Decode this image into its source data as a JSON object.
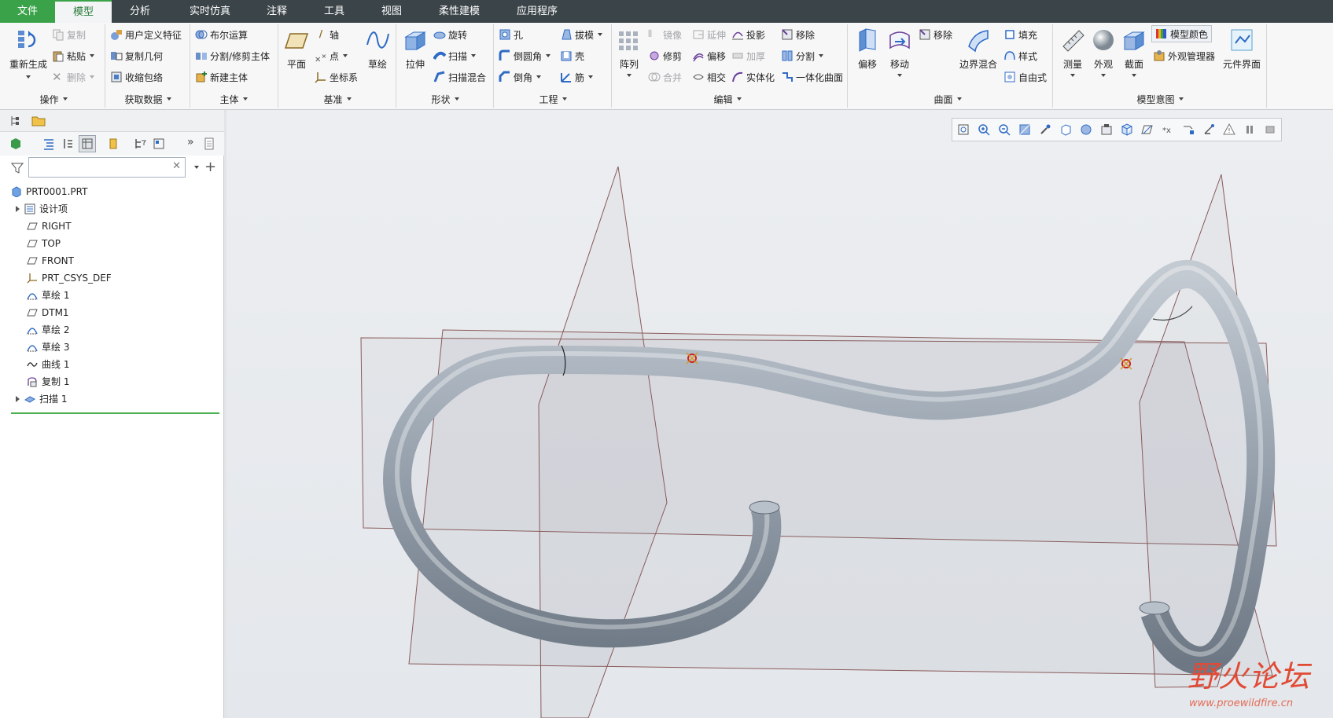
{
  "tabs": {
    "file": "文件",
    "model": "模型",
    "analysis": "分析",
    "sim": "实时仿真",
    "annotate": "注释",
    "tools": "工具",
    "view": "视图",
    "flex": "柔性建模",
    "apps": "应用程序"
  },
  "ops": {
    "regenerate": "重新生成",
    "copy": "复制",
    "paste": "粘贴",
    "delete": "删除"
  },
  "getdata": {
    "udf": "用户定义特征",
    "copygeom": "复制几何",
    "shrinkwrap": "收缩包络"
  },
  "body": {
    "boolean": "布尔运算",
    "split": "分割/修剪主体",
    "newbody": "新建主体"
  },
  "datum": {
    "plane": "平面",
    "axis": "轴",
    "point": "点",
    "csys": "坐标系",
    "sketch": "草绘"
  },
  "shapes": {
    "extrude": "拉伸",
    "revolve": "旋转",
    "sweep": "扫描",
    "sweptblend": "扫描混合"
  },
  "eng": {
    "hole": "孔",
    "round": "倒圆角",
    "chamfer": "倒角",
    "draft": "拔模",
    "shell": "壳",
    "rib": "筋"
  },
  "edit": {
    "pattern": "阵列",
    "mirror": "镜像",
    "extend": "延伸",
    "project": "投影",
    "remove": "移除",
    "trim": "修剪",
    "offset": "偏移",
    "thicken": "加厚",
    "split": "分割",
    "merge": "合并",
    "intersect": "相交",
    "solidify": "实体化",
    "unify": "一体化曲面"
  },
  "surf": {
    "offset": "偏移",
    "move": "移动",
    "remove": "移除",
    "boundary": "边界混合",
    "fill": "填充",
    "style": "样式",
    "freestyle": "自由式"
  },
  "intent": {
    "measure": "测量",
    "appearance": "外观",
    "section": "截面",
    "modelcolor": "模型颜色",
    "appmgr": "外观管理器",
    "compiface": "元件界面"
  },
  "groups": {
    "ops": "操作",
    "getdata": "获取数据",
    "body": "主体",
    "datum": "基准",
    "shapes": "形状",
    "eng": "工程",
    "edit": "编辑",
    "surf": "曲面",
    "intent": "模型意图"
  },
  "tree": {
    "root": "PRT0001.PRT",
    "items": [
      "设计项",
      "RIGHT",
      "TOP",
      "FRONT",
      "PRT_CSYS_DEF",
      "草绘 1",
      "DTM1",
      "草绘 2",
      "草绘 3",
      "曲线 1",
      "复制 1",
      "扫描 1"
    ]
  },
  "search": {
    "value": ""
  },
  "watermark": {
    "title": "野火论坛",
    "site": "www.proewildfire.cn"
  },
  "colors": {
    "accent": "#3aa34a",
    "tabbar": "#3b4449",
    "tube": "#9aa4af"
  }
}
